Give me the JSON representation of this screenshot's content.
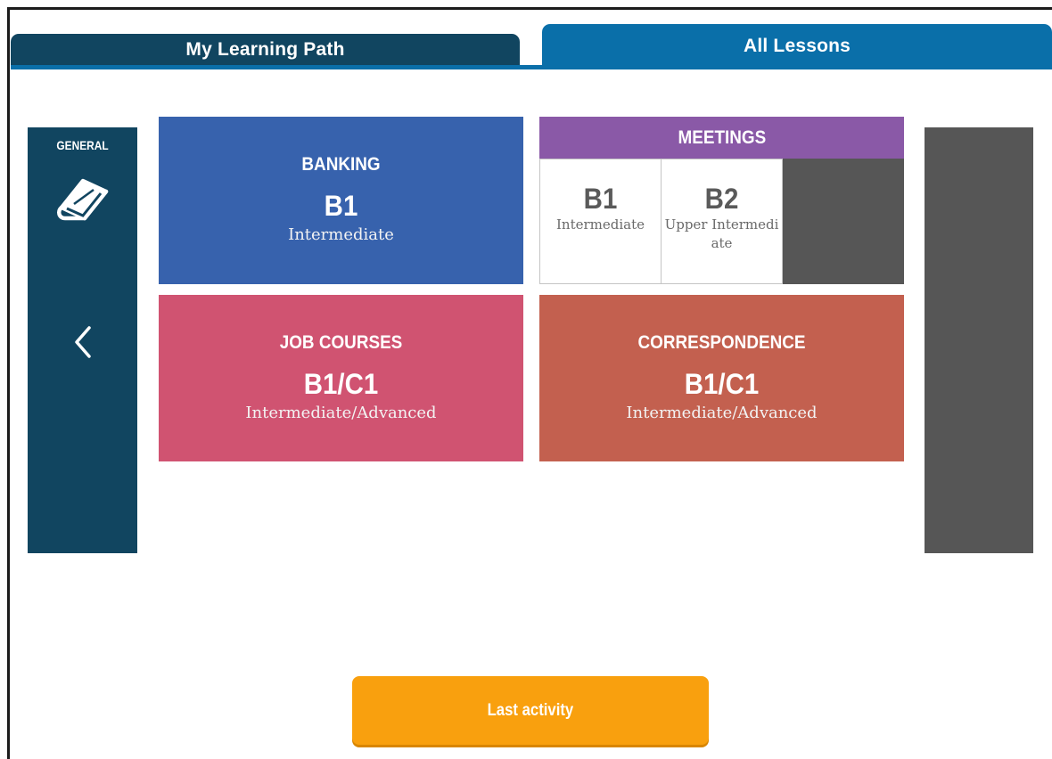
{
  "tabs": [
    {
      "label": "My Learning Path",
      "active": false
    },
    {
      "label": "All Lessons",
      "active": true
    }
  ],
  "sidebar_left": {
    "title": "GENERAL",
    "icon": "book-icon",
    "nav_icon": "chevron-left-icon"
  },
  "cards": {
    "banking": {
      "title": "BANKING",
      "level": "B1",
      "description": "Intermediate",
      "color": "#3762ad"
    },
    "meetings": {
      "title": "MEETINGS",
      "color": "#8a59a7",
      "levels": [
        {
          "level": "B1",
          "description": "Intermediate"
        },
        {
          "level": "B2",
          "description": "Upper Intermedi ate"
        }
      ]
    },
    "job_courses": {
      "title": "JOB COURSES",
      "level": "B1/C1",
      "description": "Intermediate/Advanced",
      "color": "#d05371"
    },
    "correspondence": {
      "title": "CORRESPONDENCE",
      "level": "B1/C1",
      "description": "Intermediate/Advanced",
      "color": "#c3604f"
    }
  },
  "footer": {
    "last_activity_label": "Last activity"
  },
  "colors": {
    "tab_dark": "#114560",
    "tab_active": "#0a6fa9",
    "sidebar": "#114560",
    "side_right": "#565656",
    "button": "#f9a00e"
  }
}
